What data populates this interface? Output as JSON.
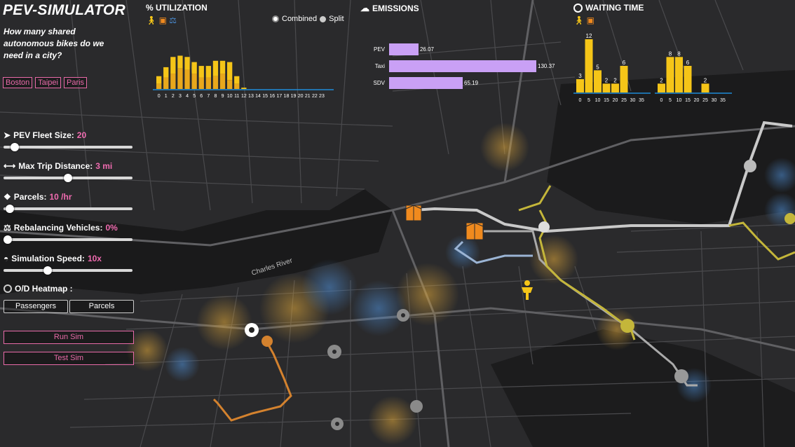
{
  "app": {
    "title": "PEV-SIMULATOR",
    "question": "How many shared autonomous bikes do we need in a city?"
  },
  "cities": [
    "Boston",
    "Taipei",
    "Paris"
  ],
  "controls": [
    {
      "label": "PEV Fleet Size:",
      "value": "20",
      "icon": "bike-icon",
      "level": 0.06
    },
    {
      "label": "Max Trip Distance:",
      "value": "3 mi",
      "icon": "arrows-icon",
      "level": 0.5
    },
    {
      "label": "Parcels:",
      "value": "10 /hr",
      "icon": "parcels-icon",
      "level": 0.02
    },
    {
      "label": "Rebalancing Vehicles:",
      "value": "0%",
      "icon": "scale-icon",
      "level": 0.0
    },
    {
      "label": "Simulation Speed:",
      "value": "10x",
      "icon": "gauge-icon",
      "level": 0.33
    }
  ],
  "heatmap": {
    "label": "O/D Heatmap :",
    "buttons": [
      "Passengers",
      "Parcels"
    ]
  },
  "actions": {
    "run": "Run Sim",
    "test": "Test Sim"
  },
  "map": {
    "river_label": "Charles River"
  },
  "utilization": {
    "title": "% UTILIZATION",
    "mode_combined": "Combined",
    "mode_split": "Split"
  },
  "emissions": {
    "title": "EMISSIONS"
  },
  "waiting": {
    "title": "WAITING TIME"
  },
  "colors": {
    "accent": "#f06bb0",
    "bar": "#f5c518",
    "bar_dark": "#e8a81c",
    "emission": "#c9a0f5",
    "axis": "#1e8bd6"
  },
  "chart_data": [
    {
      "type": "bar",
      "name": "utilization",
      "categories": [
        "0",
        "1",
        "2",
        "3",
        "4",
        "5",
        "6",
        "7",
        "8",
        "9",
        "10",
        "11",
        "12",
        "13",
        "14",
        "15",
        "16",
        "17",
        "18",
        "19",
        "20",
        "21",
        "22",
        "23"
      ],
      "series": [
        {
          "values": [
            4,
            9,
            12,
            16,
            15,
            12,
            9,
            9,
            10,
            12,
            7,
            4,
            0,
            0,
            0,
            0,
            0,
            0,
            0,
            0,
            0,
            0,
            0,
            0
          ]
        },
        {
          "values": [
            6,
            8,
            13,
            10,
            10,
            9,
            9,
            9,
            12,
            10,
            14,
            6,
            1,
            0,
            0,
            0,
            0,
            0,
            0,
            0,
            0,
            0,
            0,
            0
          ]
        }
      ],
      "ylim": [
        0,
        35
      ]
    },
    {
      "type": "bar",
      "name": "emissions",
      "orientation": "horizontal",
      "categories": [
        "PEV",
        "Taxi",
        "SDV"
      ],
      "values": [
        26.07,
        130.37,
        65.19
      ],
      "xlim": [
        0,
        130.37
      ]
    },
    {
      "type": "bar",
      "name": "waiting-time-passengers",
      "categories": [
        "0",
        "5",
        "10",
        "15",
        "20",
        "25",
        "30",
        "35"
      ],
      "values": [
        3,
        12,
        5,
        2,
        2,
        6,
        0,
        0
      ],
      "ylim": [
        0,
        12
      ]
    },
    {
      "type": "bar",
      "name": "waiting-time-parcels",
      "categories": [
        "0",
        "5",
        "10",
        "15",
        "20",
        "25",
        "30",
        "35"
      ],
      "values": [
        2,
        8,
        8,
        6,
        0,
        2,
        0,
        0
      ],
      "ylim": [
        0,
        12
      ]
    }
  ]
}
